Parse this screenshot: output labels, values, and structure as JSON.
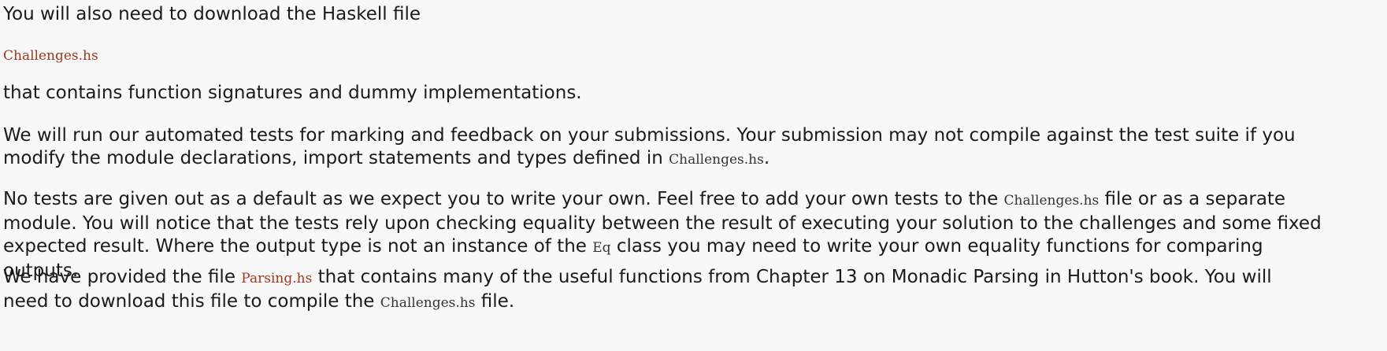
{
  "paragraphs": {
    "p1": "You will also need to download the Haskell file",
    "p2_code": "Challenges.hs",
    "p3": "that contains function signatures and dummy implementations.",
    "p4_line1": "We will run our automated tests for marking and feedback on your submissions. Your submission may not compile against the test suite if you",
    "p4_line2_pre": "modify the module declarations, import statements and types defined in ",
    "p4_line2_code": "Challenges.hs",
    "p4_line2_post": ".",
    "p5_line1_pre": "No tests are given out as a default as we expect you to write your own. Feel free to add your own tests to the ",
    "p5_line1_code": "Challenges.hs",
    "p5_line1_post": " file or as a separate",
    "p5_line2": "module. You will notice that the tests rely upon checking equality between the result of executing your solution to the challenges and some fixed",
    "p5_line3_pre": "expected result. Where the output type is not an instance of the ",
    "p5_line3_code": "Eq",
    "p5_line3_post": " class you may need to write your own equality functions for comparing",
    "p5_line4": "outputs.",
    "p6_line1_pre": "We have provided the file ",
    "p6_line1_code": "Parsing.hs",
    "p6_line1_post": " that contains many of the useful functions from Chapter 13 on Monadic Parsing in Hutton's book. You will",
    "p6_line2_pre": "need to download this file to compile the ",
    "p6_line2_code": "Challenges.hs",
    "p6_line2_post": " file."
  }
}
